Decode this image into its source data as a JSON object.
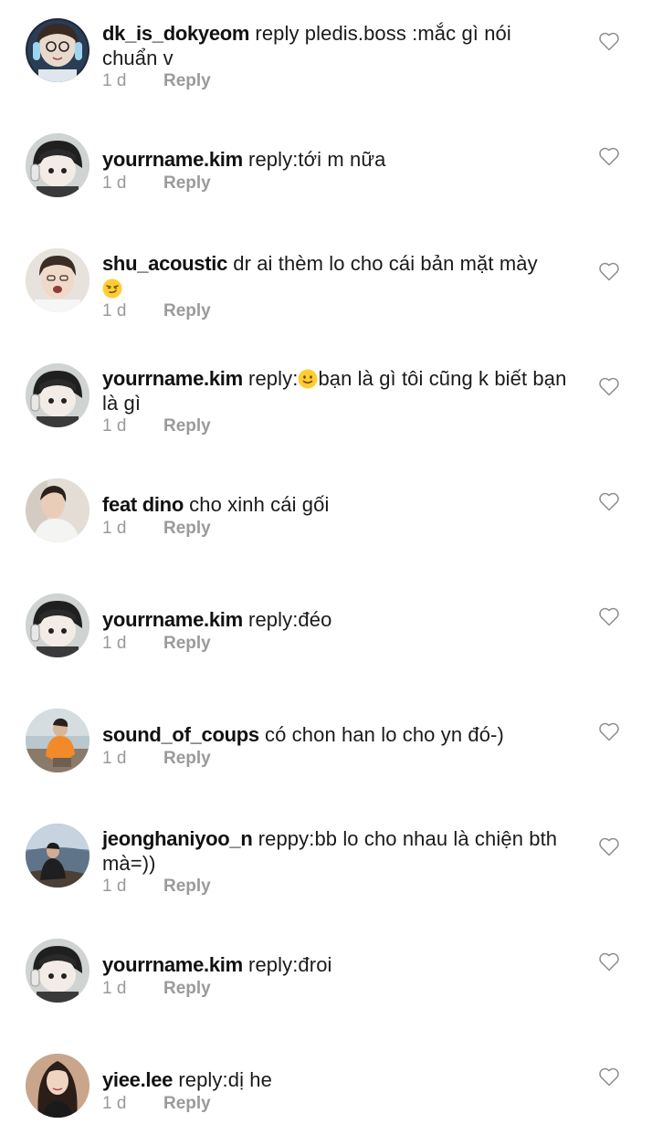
{
  "comments": [
    {
      "username": "dk_is_dokyeom",
      "text": " reply pledis.boss :mắc gì nói chuẩn v",
      "time": "1 d",
      "reply": "Reply",
      "avatar": "avatar-girl-headphones"
    },
    {
      "username": "yourrname.kim",
      "text": " reply:tới m nữa",
      "time": "1 d",
      "reply": "Reply",
      "avatar": "avatar-cartoon-boy"
    },
    {
      "username": "shu_acoustic",
      "text": " dr ai thèm lo cho cái bản mặt mày ",
      "emoji_after": "😏",
      "time": "1 d",
      "reply": "Reply",
      "avatar": "avatar-boy-white-shirt"
    },
    {
      "username": "yourrname.kim",
      "text_before": " reply:",
      "emoji_inline": "🙂",
      "text": "bạn là gì tôi cũng k biết bạn là gì",
      "time": "1 d",
      "reply": "Reply",
      "avatar": "avatar-cartoon-boy"
    },
    {
      "username": "feat dino",
      "text": " cho xinh cái gối",
      "time": "1 d",
      "reply": "Reply",
      "avatar": "avatar-boy-pillow"
    },
    {
      "username": "yourrname.kim",
      "text": " reply:đéo",
      "time": "1 d",
      "reply": "Reply",
      "avatar": "avatar-cartoon-boy"
    },
    {
      "username": "sound_of_coups",
      "text": " có chon han lo cho yn đó-)",
      "time": "1 d",
      "reply": "Reply",
      "avatar": "avatar-orange-hoodie"
    },
    {
      "username": "jeonghaniyoo_n",
      "text": " reppy:bb lo cho nhau là chiện bth mà=))",
      "time": "1 d",
      "reply": "Reply",
      "avatar": "avatar-seaside"
    },
    {
      "username": "yourrname.kim",
      "text": " reply:đroi",
      "time": "1 d",
      "reply": "Reply",
      "avatar": "avatar-cartoon-boy"
    },
    {
      "username": "yiee.lee",
      "text": " reply:dị he",
      "time": "1 d",
      "reply": "Reply",
      "avatar": "avatar-long-hair-girl"
    }
  ],
  "icons": {
    "like": "heart-outline-icon"
  },
  "colors": {
    "meta": "#9a9a9a",
    "text": "#1a1a1a"
  }
}
